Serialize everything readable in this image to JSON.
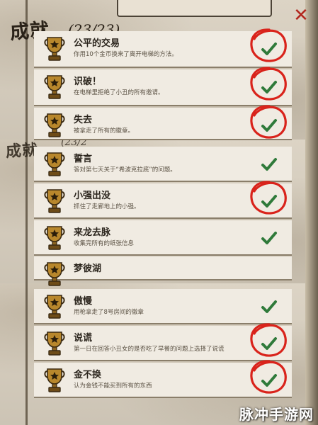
{
  "header": {
    "title": "成就",
    "count": "(23/23)",
    "ghost_title": "成就",
    "ghost_count": "(23/2"
  },
  "close_icon": "close-icon",
  "colors": {
    "check": "#2f7a3a",
    "circle": "#d9231b",
    "title_text": "#2a2218",
    "close": "#b2261d"
  },
  "achievements": [
    {
      "name": "公平的交易",
      "desc": "你用10个金币换来了离开电梯的方法。",
      "circled": true
    },
    {
      "name": "识破！",
      "desc": "在电梯里拒绝了小丑的所有邀请。",
      "circled": true
    },
    {
      "name": "失去",
      "desc": "被拿走了所有的徽章。",
      "circled": true
    },
    {
      "name": "誓言",
      "desc": "答对第七天关于“希波克拉底”的问题。",
      "circled": false
    },
    {
      "name": "小强出没",
      "desc": "抓住了走廊地上的小强。",
      "circled": true
    },
    {
      "name": "来龙去脉",
      "desc": "收集完所有的纸张信息",
      "circled": false
    },
    {
      "name": "梦彼湖",
      "desc": "",
      "circled": false
    },
    {
      "name": "傲慢",
      "desc": "用枪拿走了8号房间的徽章",
      "circled": false
    },
    {
      "name": "说谎",
      "desc": "第一日在回答小丑女的是否吃了早餐的问题上选择了说谎",
      "circled": true
    },
    {
      "name": "金不换",
      "desc": "认为金钱不能买到所有的东西",
      "circled": true
    }
  ],
  "watermark": "脉冲手游网"
}
